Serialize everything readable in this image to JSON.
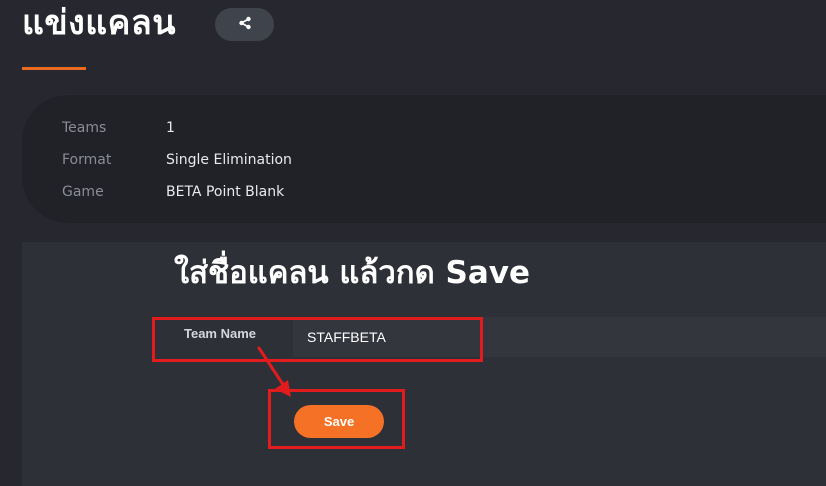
{
  "header": {
    "title": "แข่งแคลน",
    "share_icon": "share-icon",
    "accent_color": "#ea6b1f"
  },
  "info": {
    "rows": [
      {
        "label": "Teams",
        "value": "1"
      },
      {
        "label": "Format",
        "value": "Single Elimination"
      },
      {
        "label": "Game",
        "value": "BETA Point Blank"
      }
    ]
  },
  "annotation": {
    "instruction": "ใส่ชื่อแคลน แล้วกด Save",
    "highlight_color": "#e21c1c"
  },
  "form": {
    "team_name_label": "Team Name",
    "team_name_value": "STAFFBETA",
    "save_label": "Save",
    "save_color": "#f47125"
  }
}
